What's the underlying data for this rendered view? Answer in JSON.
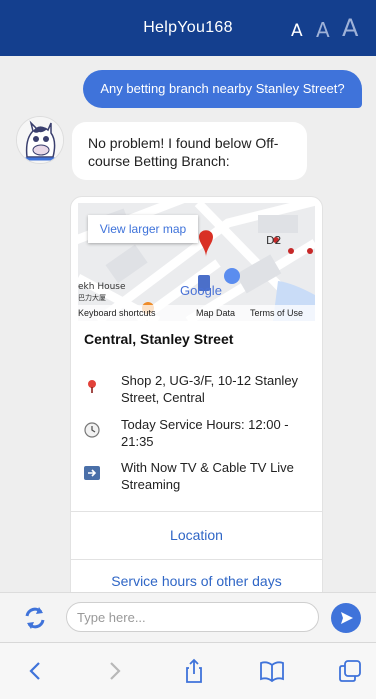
{
  "header": {
    "title": "HelpYou168",
    "font_sizes": [
      "A",
      "A",
      "A"
    ]
  },
  "chat": {
    "user_message": "Any betting branch nearby Stanley Street?",
    "bot_message": "No problem! I found below Off-course Betting Branch:"
  },
  "card": {
    "map": {
      "view_larger_map": "View larger map",
      "labels": [
        "ekh House",
        "巴力大厦",
        "D2",
        "Google"
      ],
      "footer": [
        "Keyboard shortcuts",
        "Map Data",
        "Terms of Use"
      ]
    },
    "branch_name": "Central, Stanley Street",
    "address": "Shop 2, UG-3/F, 10-12 Stanley Street, Central",
    "hours": "Today Service Hours: 12:00 - 21:35",
    "tv": "With Now TV & Cable TV Live Streaming",
    "location_link": "Location",
    "other_days_link": "Service hours of other days"
  },
  "input": {
    "placeholder": "Type here..."
  },
  "colors": {
    "header": "#143f8e",
    "accent": "#3f73da",
    "link": "#2f66c6"
  }
}
